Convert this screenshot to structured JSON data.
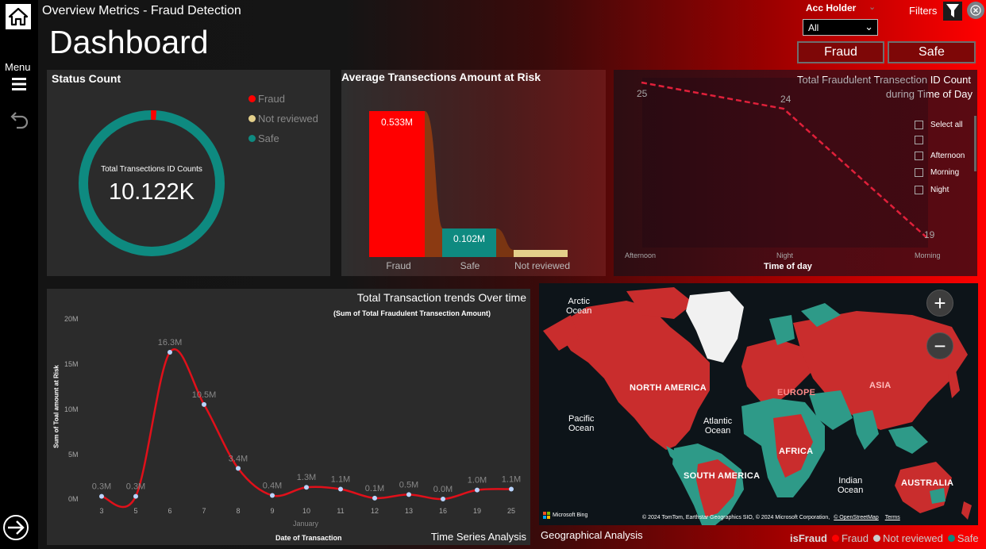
{
  "app": {
    "title": "Overview Metrics - Fraud Detection",
    "dashboard_title": "Dashboard",
    "menu_label": "Menu"
  },
  "filters": {
    "acc_holder_label": "Acc Holder",
    "acc_holder_value": "All",
    "filters_label": "Filters",
    "fraud_button": "Fraud",
    "safe_button": "Safe"
  },
  "colors": {
    "fraud": "#ff0000",
    "not_reviewed": "#e3cf8a",
    "safe": "#0e8a80"
  },
  "status_count": {
    "title": "Status Count",
    "center_label": "Total Transections ID Counts",
    "center_value": "10.122K",
    "legend": [
      "Fraud",
      "Not reviewed",
      "Safe"
    ]
  },
  "avg_amount": {
    "title": "Average Transections Amount at Risk",
    "bars": [
      {
        "category": "Fraud",
        "label": "0.533M"
      },
      {
        "category": "Safe",
        "label": "0.102M"
      },
      {
        "category": "Not reviewed",
        "label": ""
      }
    ]
  },
  "fraud_time": {
    "title_line1": "Total Fraudulent Transection ID Count",
    "title_line2": "during Time of Day",
    "data_labels": [
      "25",
      "24",
      "19"
    ],
    "x_ticks": [
      "Afternoon",
      "Night",
      "Morning"
    ],
    "x_title": "Time of day",
    "slicer": [
      "Select all",
      "",
      "Afternoon",
      "Morning",
      "Night"
    ]
  },
  "trend": {
    "title": "Total Transaction trends Over time",
    "subtitle": "(Sum of Total Fraudulent Transection  Amount)",
    "ylabel": "Sum of Toal amount at Risk",
    "xlabel": "Date of Transaction",
    "x_group": "January",
    "footer": "Time Series Analysis",
    "y_ticks": [
      "0M",
      "5M",
      "10M",
      "15M",
      "20M"
    ]
  },
  "geo": {
    "title": "Geographical Analysis",
    "labels": {
      "arctic": "Arctic\nOcean",
      "pacific": "Pacific\nOcean",
      "atlantic": "Atlantic\nOcean",
      "indian": "Indian\nOcean",
      "north_america": "NORTH AMERICA",
      "south_america": "SOUTH AMERICA",
      "europe": "EUROPE",
      "asia": "ASIA",
      "africa": "AFRICA",
      "australia": "AUSTRALIA"
    },
    "bing": "Microsoft Bing",
    "copyright": "© 2024 TomTom, Earthstar Geographics SIO, © 2024 Microsoft Corporation,",
    "osm": "© OpenStreetMap",
    "terms": "Terms",
    "legend_title": "isFraud",
    "legend": [
      "Fraud",
      "Not reviewed",
      "Safe"
    ]
  },
  "chart_data": [
    {
      "type": "pie",
      "title": "Status Count",
      "categories": [
        "Fraud",
        "Not reviewed",
        "Safe"
      ],
      "values": [
        0.01,
        0.0,
        0.99
      ],
      "center_text": "10.122K"
    },
    {
      "type": "bar",
      "title": "Average Transections Amount at Risk",
      "categories": [
        "Fraud",
        "Safe",
        "Not reviewed"
      ],
      "values": [
        0.533,
        0.102,
        0.02
      ],
      "unit": "M"
    },
    {
      "type": "line",
      "title": "Total Fraudulent Transection ID Count during Time of Day",
      "xlabel": "Time of day",
      "categories": [
        "Afternoon",
        "Night",
        "Morning"
      ],
      "values": [
        25,
        24,
        19
      ]
    },
    {
      "type": "line",
      "title": "Total Transaction trends Over time",
      "xlabel": "Date of Transaction",
      "ylabel": "Sum of Toal amount at Risk",
      "x": [
        3,
        5,
        6,
        7,
        8,
        9,
        10,
        11,
        12,
        13,
        16,
        19,
        25
      ],
      "values": [
        0.3,
        0.3,
        16.3,
        10.5,
        3.4,
        0.4,
        1.3,
        1.1,
        0.1,
        0.5,
        0.0,
        1.0,
        1.1
      ],
      "labels": [
        "0.3M",
        "0.3M",
        "16.3M",
        "10.5M",
        "3.4M",
        "0.4M",
        "1.3M",
        "1.1M",
        "0.1M",
        "0.5M",
        "0.0M",
        "1.0M",
        "1.1M"
      ],
      "ylim": [
        0,
        20
      ],
      "y_ticks": [
        0,
        5,
        10,
        15,
        20
      ]
    }
  ]
}
